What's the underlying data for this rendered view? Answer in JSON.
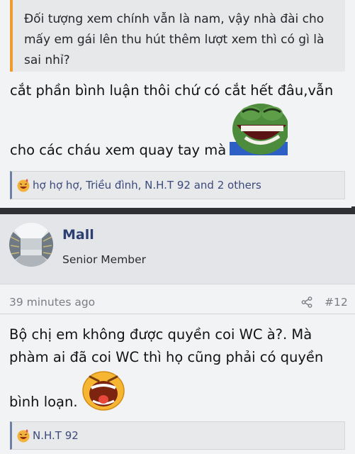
{
  "post1": {
    "quote_line1": "Đối tượng xem chính vẫn là nam, vậy nhà đài cho",
    "quote_line2": "mấy em gái lên thu hút thêm lượt xem thì có gì là",
    "quote_line3": "sai nhỉ?",
    "text_line1": "cắt phần bình luận thôi chứ có cắt hết đâu,vẫn",
    "text_line2": "cho các cháu xem quay tay mà",
    "sticker_icon": "laughing-pepe-icon",
    "reactions_text": "hợ hợ hợ, Triều đình, N.H.T 92 and 2 others"
  },
  "post2": {
    "username": "Mall",
    "user_title": "Senior Member",
    "time": "39 minutes ago",
    "post_number": "#12",
    "text_line1": "Bộ chị em không được quyền coi WC à?. Mà",
    "text_line2": "phàm ai đã coi WC thì họ cũng phải có quyền",
    "text_line3": "bình loạn.",
    "sticker_icon": "laughing-face-icon",
    "reactions_text": "N.H.T 92"
  },
  "colors": {
    "accent_quote": "#f19b2c",
    "username": "#2c3f72",
    "reaction_link": "#3b4a7a"
  }
}
